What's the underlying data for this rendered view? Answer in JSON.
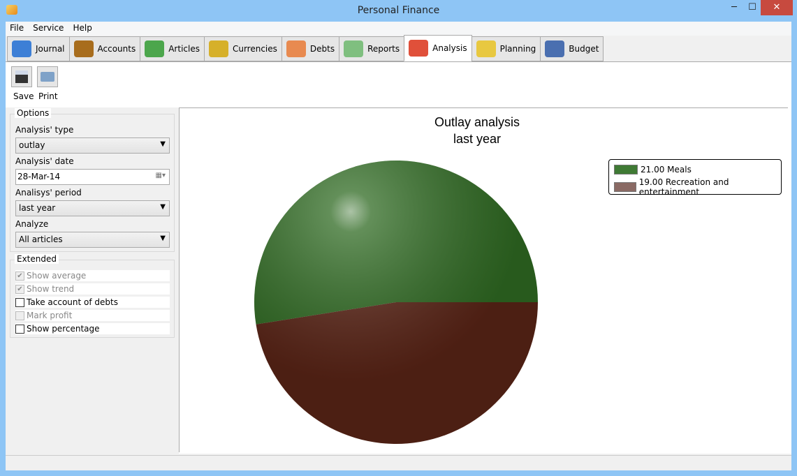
{
  "window": {
    "title": "Personal Finance",
    "controls": [
      "─",
      "☐",
      "✕"
    ]
  },
  "menu": [
    "File",
    "Service",
    "Help"
  ],
  "tabs": [
    {
      "label": "Journal",
      "icon": "book-icon",
      "color": "#3d7fd6"
    },
    {
      "label": "Accounts",
      "icon": "wallet-icon",
      "color": "#a86d1d"
    },
    {
      "label": "Articles",
      "icon": "envelope-money-icon",
      "color": "#4ca64c"
    },
    {
      "label": "Currencies",
      "icon": "coins-icon",
      "color": "#d6b02a"
    },
    {
      "label": "Debts",
      "icon": "handshake-icon",
      "color": "#e88a50"
    },
    {
      "label": "Reports",
      "icon": "calculator-icon",
      "color": "#7fbf7f"
    },
    {
      "label": "Analysis",
      "icon": "pie-chart-icon",
      "color": "#e0503a",
      "active": true
    },
    {
      "label": "Planning",
      "icon": "folder-clock-icon",
      "color": "#e8c840"
    },
    {
      "label": "Budget",
      "icon": "paragraph-icon",
      "color": "#4a6fb0"
    }
  ],
  "toolbar": {
    "save": "Save",
    "print": "Print"
  },
  "options": {
    "title": "Options",
    "type_label": "Analysis' type",
    "type_value": "outlay",
    "date_label": "Analysis' date",
    "date_value": "28-Mar-14",
    "period_label": "Analisys' period",
    "period_value": "last year",
    "analyze_label": "Analyze",
    "analyze_value": "All articles"
  },
  "extended": {
    "title": "Extended",
    "items": [
      {
        "label": "Show average",
        "checked": true,
        "disabled": true
      },
      {
        "label": "Show trend",
        "checked": true,
        "disabled": true
      },
      {
        "label": "Take account of debts",
        "checked": false,
        "disabled": false
      },
      {
        "label": "Mark profit",
        "checked": false,
        "disabled": true
      },
      {
        "label": "Show percentage",
        "checked": false,
        "disabled": false
      }
    ]
  },
  "chart_data": {
    "type": "pie",
    "title": [
      "Outlay analysis",
      "last year"
    ],
    "legend_position": "top-right",
    "slices": [
      {
        "label": "21.00 Meals",
        "name": "Meals",
        "value": 21,
        "color": "#2f6a22"
      },
      {
        "label": "19.00 Recreation and entertainment",
        "name": "Recreation and entertainment",
        "value": 19,
        "color": "#5a2416"
      }
    ]
  }
}
